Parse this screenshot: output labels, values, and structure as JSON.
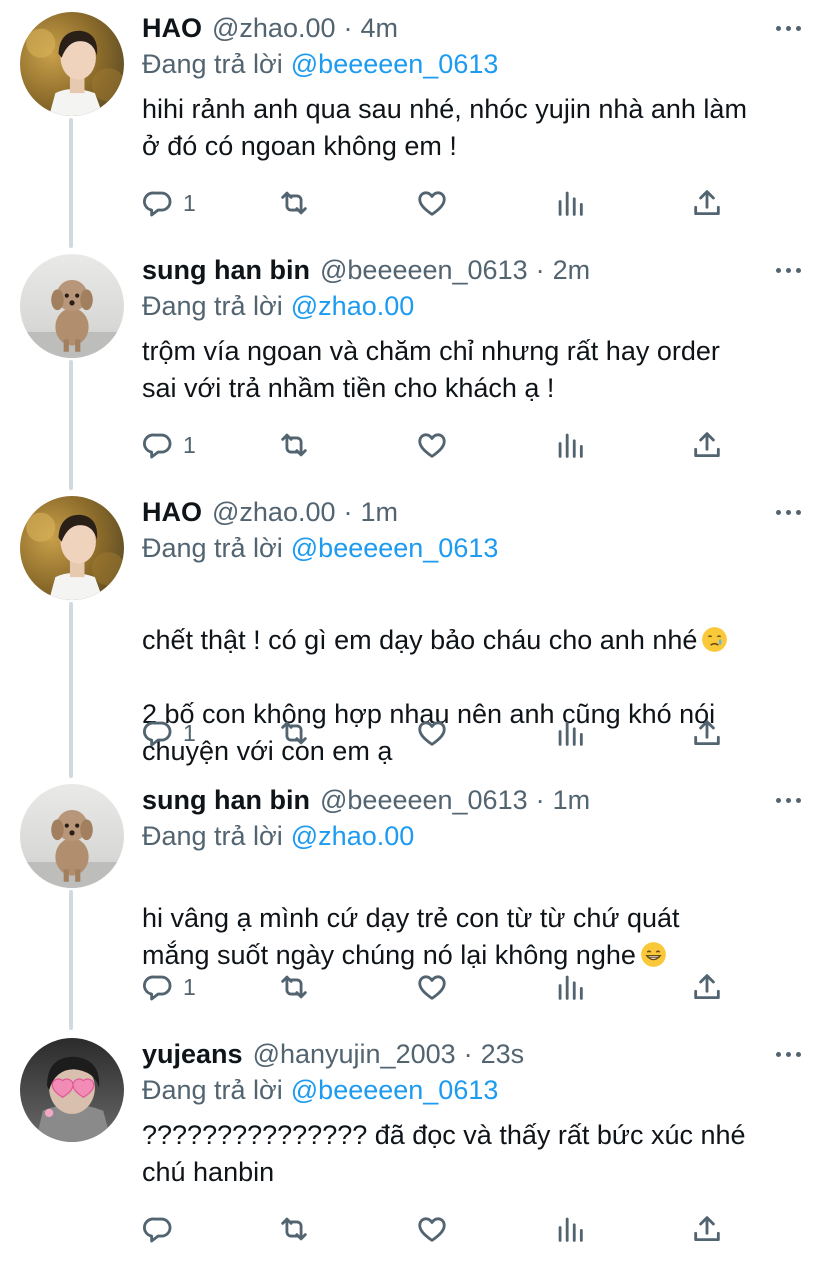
{
  "tweets": [
    {
      "name": "HAO",
      "handle": "@zhao.00",
      "time": "4m",
      "reply_prefix": "Đang trả lời",
      "reply_to": "@beeeeen_0613",
      "text": "hihi rảnh anh qua sau nhé, nhóc yujin nhà anh làm\nở đó có ngoan không em !",
      "reply_count": "1",
      "avatar": "person-avatar"
    },
    {
      "name": "sung han bin",
      "handle": "@beeeeen_0613",
      "time": "2m",
      "reply_prefix": "Đang trả lời",
      "reply_to": "@zhao.00",
      "text": "trộm vía ngoan và chăm chỉ nhưng rất hay order\nsai với trả nhầm tiền cho khách ạ !",
      "reply_count": "1",
      "avatar": "dog-avatar"
    },
    {
      "name": "HAO",
      "handle": "@zhao.00",
      "time": "1m",
      "reply_prefix": "Đang trả lời",
      "reply_to": "@beeeeen_0613",
      "text": "chết thật ! có gì em dạy bảo cháu cho anh nhé",
      "text2": "2 bố con không hợp nhau nên anh cũng khó nói\nchuyện với con em ạ",
      "emoji": "crying-face-emoji",
      "reply_count": "1",
      "avatar": "person-avatar"
    },
    {
      "name": "sung han bin",
      "handle": "@beeeeen_0613",
      "time": "1m",
      "reply_prefix": "Đang trả lời",
      "reply_to": "@zhao.00",
      "text": "hi vâng ạ mình cứ dạy trẻ con từ từ chứ quát\nmắng suốt ngày chúng nó lại không nghe",
      "emoji": "grinning-face-emoji",
      "reply_count": "1",
      "avatar": "dog-avatar"
    },
    {
      "name": "yujeans",
      "handle": "@hanyujin_2003",
      "time": "23s",
      "reply_prefix": "Đang trả lời",
      "reply_to": "@beeeeen_0613",
      "text": "??????????????? đã đọc và thấy rất bức xúc nhé\nchú hanbin",
      "reply_count": "",
      "avatar": "heart-glasses-avatar"
    }
  ],
  "separator": "·",
  "colors": {
    "text": "#0f1419",
    "secondary": "#536471",
    "accent": "#1d9bf0",
    "thread_line": "#cfd9de"
  },
  "icons": [
    "reply-icon",
    "retweet-icon",
    "like-icon",
    "analytics-icon",
    "share-icon",
    "more-icon"
  ]
}
